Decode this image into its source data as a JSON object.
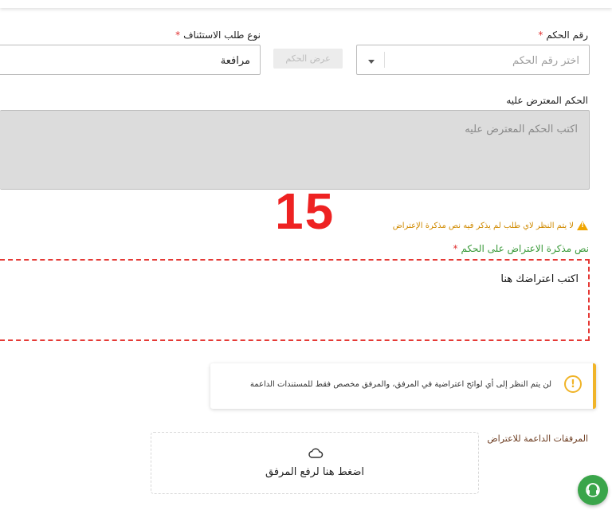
{
  "judgment_number": {
    "label": "رقم الحكم",
    "placeholder": "اختر رقم الحكم"
  },
  "appeal_type": {
    "label": "نوع طلب الاستئناف",
    "value": "مرافعة"
  },
  "view_judgment_button": "عرض الحكم",
  "objected_judgment": {
    "label": "الحكم المعترض عليه",
    "placeholder": "اكتب الحكم المعترض عليه"
  },
  "annotation_number": "15",
  "warning_text": "لا يتم النظر لاي طلب لم يذكر فيه نص مذكرة الإعتراض",
  "objection_memo": {
    "label": "نص مذكرة الاعتراض على الحكم",
    "value": "اكتب اعتراضك هنا"
  },
  "alert_message": "لن يتم النظر إلى أي لوائح اعتراضية في المرفق، والمرفق مخصص فقط للمستندات الداعمة",
  "attachments": {
    "label": "المرفقات الداعمة للاعتراض",
    "upload_text": "اضغط هنا لرفع المرفق"
  },
  "required_marker": "*",
  "colors": {
    "accent_green": "#3aa54a",
    "warning_orange": "#f0a500",
    "annotation_red": "#e53935",
    "memo_label_green": "#3a9a3a"
  }
}
